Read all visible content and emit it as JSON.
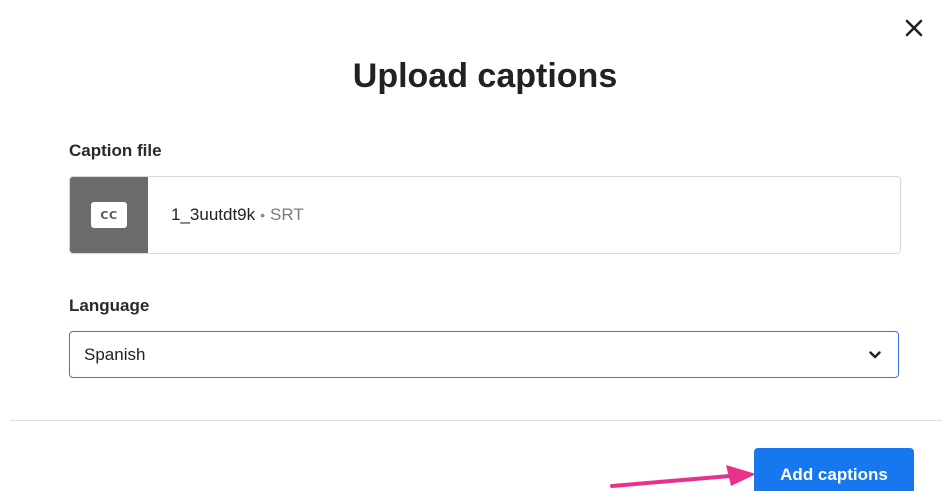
{
  "dialog": {
    "title": "Upload captions",
    "close_icon": "close-icon"
  },
  "caption_file": {
    "label": "Caption file",
    "icon_text": "CC",
    "file_name": "1_3uutdt9k",
    "separator": "•",
    "file_type": "SRT"
  },
  "language": {
    "label": "Language",
    "selected": "Spanish",
    "chevron_icon": "chevron-down-icon"
  },
  "footer": {
    "submit_label": "Add captions"
  },
  "colors": {
    "accent": "#1677ef",
    "focus_border": "#2f7ae5",
    "arrow": "#e8318b",
    "thumb_bg": "#6b6b6b"
  }
}
